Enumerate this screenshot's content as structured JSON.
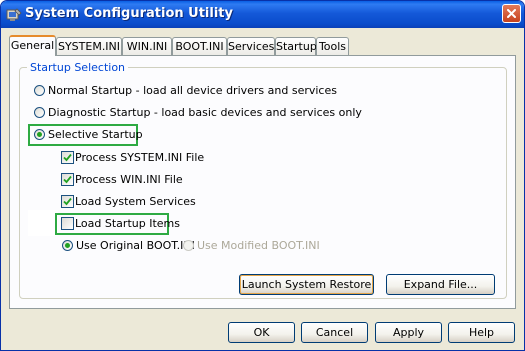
{
  "window": {
    "title": "System Configuration Utility"
  },
  "tabs": [
    {
      "label": "General",
      "active": true
    },
    {
      "label": "SYSTEM.INI"
    },
    {
      "label": "WIN.INI"
    },
    {
      "label": "BOOT.INI"
    },
    {
      "label": "Services"
    },
    {
      "label": "Startup"
    },
    {
      "label": "Tools"
    }
  ],
  "startup_selection": {
    "label": "Startup Selection",
    "options": {
      "normal": {
        "label": "Normal Startup - load all device drivers and services",
        "selected": false
      },
      "diagnostic": {
        "label": "Diagnostic Startup - load basic devices and services only",
        "selected": false
      },
      "selective": {
        "label": "Selective Startup",
        "selected": true
      }
    },
    "selective_items": {
      "system_ini": {
        "label": "Process SYSTEM.INI File",
        "checked": true
      },
      "win_ini": {
        "label": "Process WIN.INI File",
        "checked": true
      },
      "system_services": {
        "label": "Load System Services",
        "checked": true
      },
      "startup_items": {
        "label": "Load Startup Items",
        "checked": false
      }
    },
    "boot_ini": {
      "original": {
        "label": "Use Original BOOT.INI",
        "selected": true
      },
      "modified": {
        "label": "Use Modified BOOT.INI",
        "selected": false,
        "disabled": true
      }
    }
  },
  "buttons": {
    "launch_system_restore": "Launch System Restore",
    "expand_file": "Expand File...",
    "ok": "OK",
    "cancel": "Cancel",
    "apply": "Apply",
    "help": "Help"
  },
  "colors": {
    "title_bar": "#0A5FE4",
    "group_label": "#0046D5",
    "highlight_box": "#2EAA43",
    "radio_dot": "#21A121"
  },
  "icons": {
    "app": "system-config-icon",
    "close": "close-icon"
  }
}
